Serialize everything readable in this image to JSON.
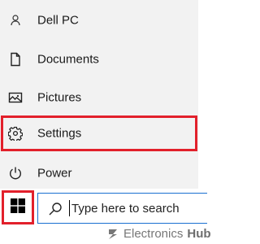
{
  "start_menu": {
    "items": [
      {
        "label": "Dell PC",
        "icon": "user-icon",
        "highlighted": false
      },
      {
        "label": "Documents",
        "icon": "document-icon",
        "highlighted": false
      },
      {
        "label": "Pictures",
        "icon": "pictures-icon",
        "highlighted": false
      },
      {
        "label": "Settings",
        "icon": "gear-icon",
        "highlighted": true
      },
      {
        "label": "Power",
        "icon": "power-icon",
        "highlighted": false
      }
    ]
  },
  "taskbar": {
    "start_button_icon": "windows-logo-icon",
    "search_icon": "search-icon",
    "search_placeholder": "Type here to search"
  },
  "watermark": {
    "word1": "Electronics",
    "word2": "Hub"
  },
  "colors": {
    "menu_background": "#f2f2f2",
    "highlight_border": "#e2202b",
    "search_border": "#1a6fd0",
    "text": "#1a1a1a"
  }
}
